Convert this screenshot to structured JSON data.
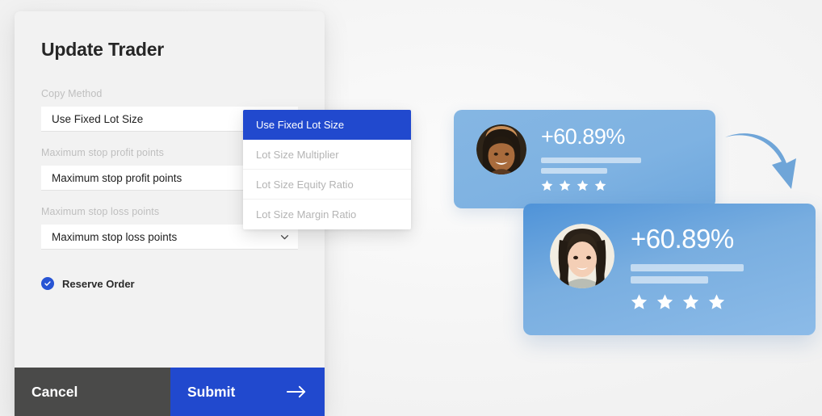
{
  "background_color": "#f4f4f4",
  "accent_blue": "#2149ce",
  "modal": {
    "title": "Update Trader",
    "fields": [
      {
        "label": "Copy Method",
        "value": "Use Fixed Lot Size",
        "has_chevron": false
      },
      {
        "label": "Maximum stop profit points",
        "value": "Maximum stop profit points",
        "has_chevron": false
      },
      {
        "label": "Maximum stop loss points",
        "value": "Maximum stop loss points",
        "has_chevron": true
      }
    ],
    "checkbox": {
      "label": "Reserve Order",
      "checked": true,
      "color": "#2754d4"
    },
    "footer": {
      "cancel_label": "Cancel",
      "cancel_color": "#4a4a49",
      "submit_label": "Submit",
      "submit_color": "#2149ce",
      "submit_icon": "arrow-right-icon"
    }
  },
  "dropdown": {
    "options": [
      "Use Fixed Lot Size",
      "Lot Size Multiplier",
      "Lot Size Equity Ratio",
      "Lot Size Margin Ratio"
    ],
    "selected_index": 0,
    "selected_bg": "#2149ce"
  },
  "cards": [
    {
      "percent": "+60.89%",
      "stars": 4,
      "avatar": "male-avatar",
      "bars": 2
    },
    {
      "percent": "+60.89%",
      "stars": 4,
      "avatar": "female-avatar",
      "bars": 2
    }
  ],
  "decoration": {
    "arrow": "curved-arrow-icon",
    "arrow_color": "#6fa5d8"
  }
}
